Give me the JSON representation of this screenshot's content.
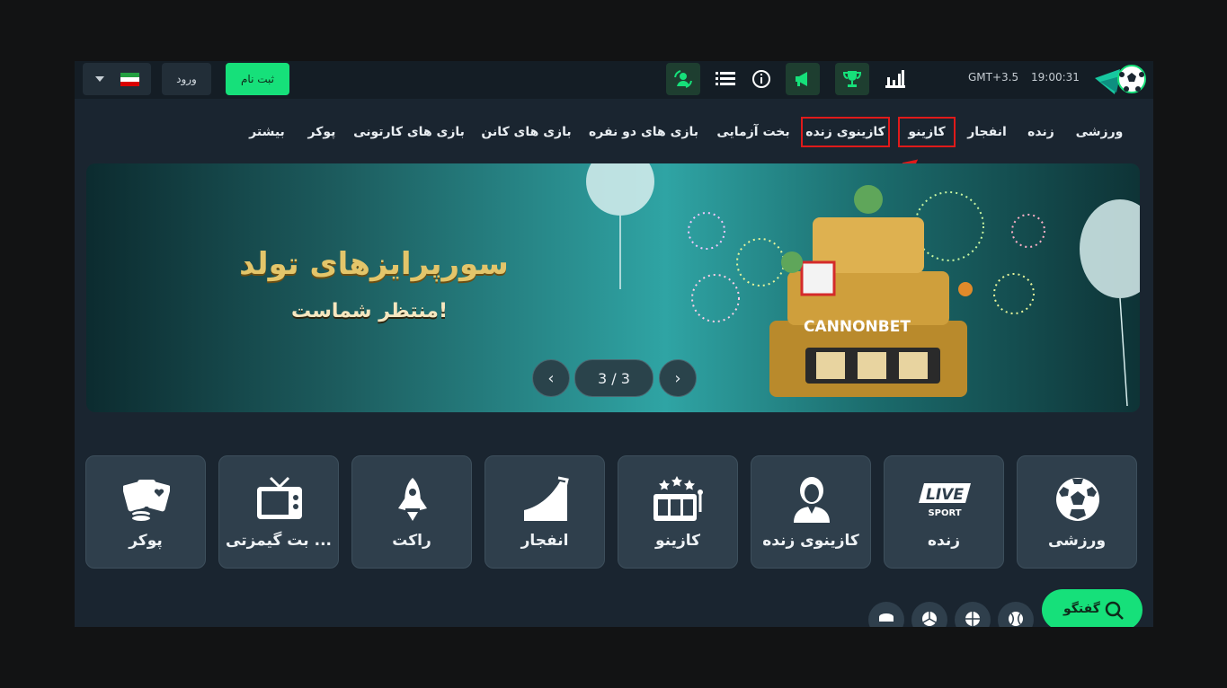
{
  "header": {
    "login_label": "ورود",
    "register_label": "ثبت نام",
    "timezone": "GMT+3.5",
    "clock": "19:00:31"
  },
  "nav": {
    "items": [
      "ورزشی",
      "زنده",
      "انفجار",
      "کازینو",
      "کازینوی زنده",
      "بخت آزمایی",
      "بازی های دو نفره",
      "بازی های کانن",
      "بازی های کارتونی",
      "پوکر",
      "بیشتر"
    ]
  },
  "banner": {
    "title": "سورپرایزهای تولد",
    "subtitle": "منتظر شماست!",
    "counter": "3 / 3",
    "brand": "CANNONBET"
  },
  "categories": [
    {
      "label": "ورزشی",
      "icon": "soccer-ball-icon"
    },
    {
      "label": "زنده",
      "icon": "live-sport-icon"
    },
    {
      "label": "کازینوی زنده",
      "icon": "dealer-icon"
    },
    {
      "label": "کازینو",
      "icon": "slot-machine-icon"
    },
    {
      "label": "انفجار",
      "icon": "crash-graph-icon"
    },
    {
      "label": "راکت",
      "icon": "rocket-icon"
    },
    {
      "label": "بت گیمزتی ...",
      "icon": "tv-icon"
    },
    {
      "label": "پوکر",
      "icon": "poker-cards-icon"
    }
  ],
  "live_icon_text": {
    "live": "LIVE",
    "sport": "SPORT"
  },
  "chat": {
    "label": "گفتگو"
  },
  "colors": {
    "accent": "#16e07a",
    "background": "#1a2530",
    "highlight": "#e01a1a"
  }
}
